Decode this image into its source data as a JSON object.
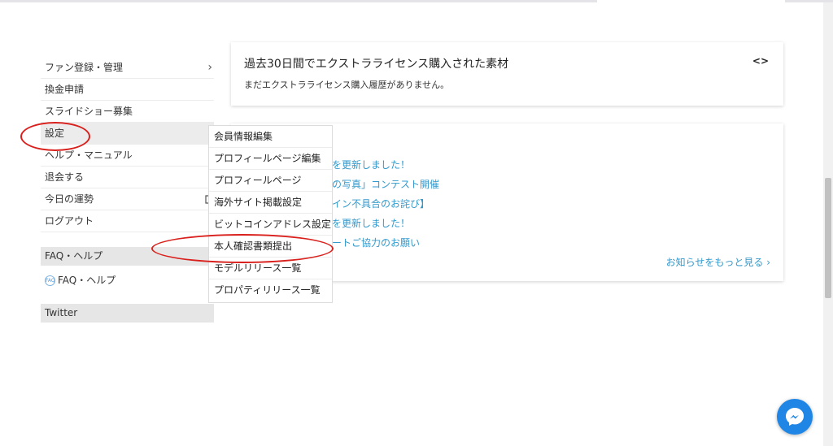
{
  "sidebar": {
    "items": [
      {
        "label": "ファン登録・管理",
        "chevron": "chevron-right-icon"
      },
      {
        "label": "換金申請"
      },
      {
        "label": "スライドショー募集"
      },
      {
        "label": "設定"
      },
      {
        "label": "ヘルプ・マニュアル"
      },
      {
        "label": "退会する"
      },
      {
        "label": "今日の運勢",
        "icon": "external-link-icon"
      },
      {
        "label": "ログアウト"
      }
    ],
    "faq_section": "FAQ・ヘルプ",
    "faq_link": "FAQ・ヘルプ",
    "twitter_section": "Twitter"
  },
  "submenu": {
    "items": [
      "会員情報編集",
      "プロフィールページ編集",
      "プロフィールページ",
      "海外サイト掲載設定",
      "ビットコインアドレス設定",
      "本人確認書類提出",
      "モデルリリース一覧",
      "プロパティリリース一覧"
    ]
  },
  "extended_license": {
    "title": "過去30日間でエクストラライセンス購入された素材",
    "empty_message": "まだエクストラライセンス購入履歴がありません。"
  },
  "news": {
    "items": [
      "アを更新しました！",
      "らの写真」コンテスト開催",
      "ザイン不具合のお詫び】",
      "アを更新しました！",
      "ケートご協力のお願い"
    ],
    "more_label": "お知らせをもっと見る ›"
  },
  "colors": {
    "link": "#3399cc",
    "annotation": "#d9201c",
    "messenger": "#1f86e6"
  }
}
